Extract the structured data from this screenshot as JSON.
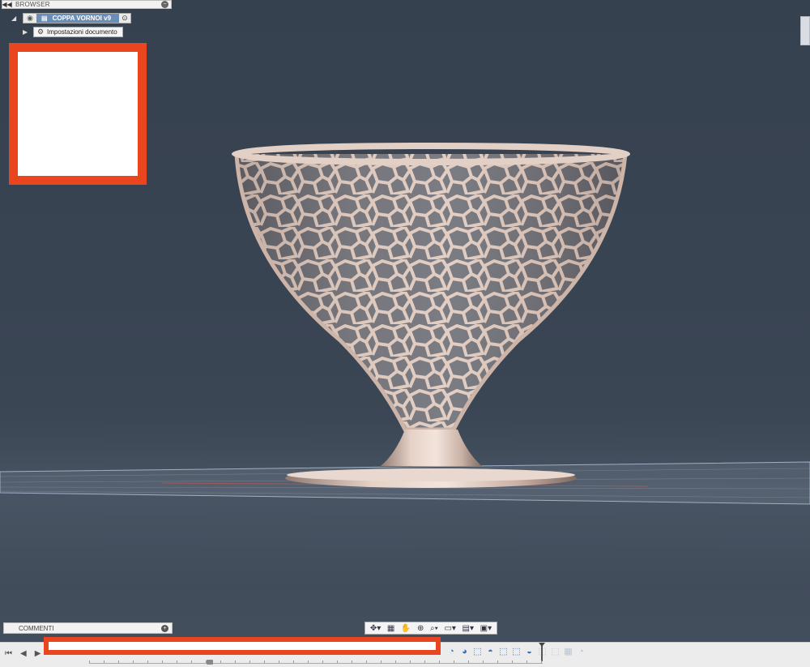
{
  "browser": {
    "title": "BROWSER",
    "root_label": "COPPA VORNOI v9",
    "child_label": "Impostazioni documento"
  },
  "comments": {
    "title": "COMMENTI"
  },
  "icons": {
    "collapse": "double-left-arrow-icon",
    "close": "close-circle-icon",
    "eye": "eye-icon",
    "target": "activate-target-icon",
    "gear": "gear-icon",
    "plus": "plus-circle-icon"
  },
  "colors": {
    "viewport_bg": "#3a4554",
    "model": "#d4bcb0",
    "highlight": "#6b8eb9",
    "redaction": "#e9461f"
  }
}
